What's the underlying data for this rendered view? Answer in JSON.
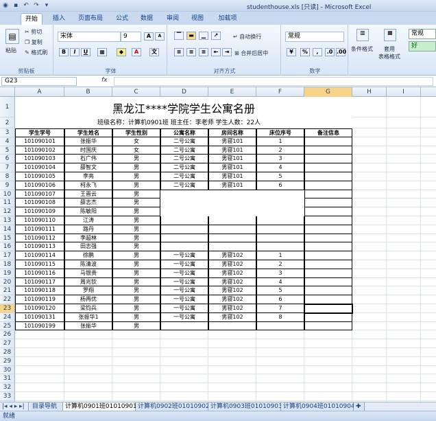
{
  "window": {
    "title": "studenthouse.xls [只读] - Microsoft Excel"
  },
  "ribbon_tabs": [
    "开始",
    "插入",
    "页面布局",
    "公式",
    "数据",
    "审阅",
    "视图",
    "加载项"
  ],
  "ribbon": {
    "clipboard": {
      "paste": "粘贴",
      "cut": "剪切",
      "copy": "复制",
      "format_painter": "格式刷",
      "label": "剪贴板"
    },
    "font": {
      "name": "宋体",
      "size": "9",
      "label": "字体",
      "bold": "B",
      "italic": "I",
      "underline": "U",
      "font_color": "A",
      "size_up": "A",
      "size_down": "A"
    },
    "alignment": {
      "wrap": "自动换行",
      "merge": "合并后居中",
      "label": "对齐方式"
    },
    "number": {
      "format": "常规",
      "label": "数字"
    },
    "styles": {
      "conditional": "条件格式",
      "table": "套用\n表格格式",
      "normal": "常规",
      "good": "好"
    }
  },
  "formula_bar": {
    "name_box": "G23",
    "fx": "fx",
    "value": ""
  },
  "columns": [
    "A",
    "B",
    "C",
    "D",
    "E",
    "F",
    "G",
    "H",
    "I"
  ],
  "selected_column": "G",
  "selected_row": 23,
  "sheet": {
    "title": "黑龙江****学院学生公寓名册",
    "subtitle": "班级名称：计算机0901班  班主任：李老师  学生人数：22人",
    "headers": [
      "学生学号",
      "学生姓名",
      "学生性别",
      "公寓名称",
      "房间名称",
      "床位序号",
      "备注信息"
    ],
    "rows": [
      [
        "101090101",
        "张振华",
        "女",
        "二号公寓",
        "男寝101",
        "1",
        ""
      ],
      [
        "101090102",
        "时国庆",
        "女",
        "二号公寓",
        "男寝101",
        "2",
        ""
      ],
      [
        "101090103",
        "石广伟",
        "男",
        "二号公寓",
        "男寝101",
        "3",
        ""
      ],
      [
        "101090104",
        "薛智文",
        "男",
        "二号公寓",
        "男寝101",
        "4",
        ""
      ],
      [
        "101090105",
        "李亮",
        "男",
        "二号公寓",
        "男寝101",
        "5",
        ""
      ],
      [
        "101090106",
        "柯永飞",
        "男",
        "二号公寓",
        "男寝101",
        "6",
        ""
      ],
      [
        "101090107",
        "王晋云",
        "男",
        "",
        "",
        "",
        ""
      ],
      [
        "101090108",
        "薛志杰",
        "男",
        "",
        "",
        "",
        ""
      ],
      [
        "101090109",
        "陈敏阳",
        "男",
        "",
        "",
        "",
        ""
      ],
      [
        "101090110",
        "江涛",
        "男",
        "",
        "",
        "",
        ""
      ],
      [
        "101090111",
        "路丹",
        "男",
        "",
        "",
        "",
        ""
      ],
      [
        "101090112",
        "李超林",
        "男",
        "",
        "",
        "",
        ""
      ],
      [
        "101090113",
        "田志强",
        "男",
        "",
        "",
        "",
        ""
      ],
      [
        "101090114",
        "徐鹏",
        "男",
        "一号公寓",
        "男寝102",
        "1",
        ""
      ],
      [
        "101090115",
        "陈清波",
        "男",
        "一号公寓",
        "男寝102",
        "2",
        ""
      ],
      [
        "101090116",
        "马银贵",
        "男",
        "一号公寓",
        "男寝102",
        "3",
        ""
      ],
      [
        "101090117",
        "周兆钦",
        "男",
        "一号公寓",
        "男寝102",
        "4",
        ""
      ],
      [
        "101090118",
        "罗翔",
        "男",
        "一号公寓",
        "男寝102",
        "5",
        ""
      ],
      [
        "101090119",
        "杨再优",
        "男",
        "一号公寓",
        "男寝102",
        "6",
        ""
      ],
      [
        "101090120",
        "梁钧兵",
        "男",
        "一号公寓",
        "男寝102",
        "7",
        ""
      ],
      [
        "101090131",
        "张振华1",
        "男",
        "一号公寓",
        "男寝102",
        "8",
        ""
      ],
      [
        "101090199",
        "张振华",
        "男",
        "",
        "",
        "",
        ""
      ]
    ]
  },
  "sheet_tabs": [
    "目录导航",
    "计算机0901班01010901",
    "计算机0902班01010902",
    "计算机0903班01010903",
    "计算机0904班01010904"
  ],
  "active_sheet": 1,
  "status": "就绪"
}
